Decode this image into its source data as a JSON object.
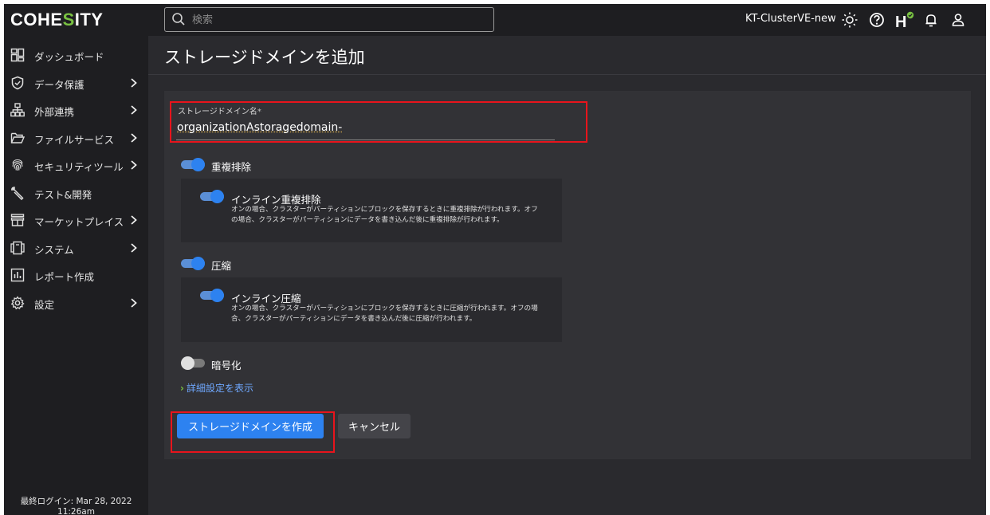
{
  "brand": {
    "logo_left": "COHE",
    "logo_accent": "S",
    "logo_right": "ITY",
    "accent_color": "#79c142"
  },
  "search": {
    "placeholder": "検索"
  },
  "topbar": {
    "cluster_name": "KT-ClusterVE-new",
    "icons": [
      "theme-sun-icon",
      "help-icon",
      "health-icon",
      "notification-bell-icon",
      "user-icon"
    ]
  },
  "sidebar": {
    "items": [
      {
        "label": "ダッシュボード",
        "icon": "dashboard-icon",
        "has_chevron": false
      },
      {
        "label": "データ保護",
        "icon": "shield-icon",
        "has_chevron": true
      },
      {
        "label": "外部連携",
        "icon": "hierarchy-icon",
        "has_chevron": true
      },
      {
        "label": "ファイルサービス",
        "icon": "folder-icon",
        "has_chevron": true
      },
      {
        "label": "セキュリティツール",
        "icon": "fingerprint-icon",
        "has_chevron": true
      },
      {
        "label": "テスト&開発",
        "icon": "wrench-icon",
        "has_chevron": false
      },
      {
        "label": "マーケットプレイス",
        "icon": "store-icon",
        "has_chevron": true
      },
      {
        "label": "システム",
        "icon": "system-icon",
        "has_chevron": true
      },
      {
        "label": "レポート作成",
        "icon": "report-icon",
        "has_chevron": false
      },
      {
        "label": "設定",
        "icon": "gear-icon",
        "has_chevron": true
      }
    ],
    "last_login_line1": "最終ログイン: Mar 28, 2022",
    "last_login_line2": "11:26am"
  },
  "page": {
    "title": "ストレージドメインを追加"
  },
  "form": {
    "name_label": "ストレージドメイン名",
    "name_required_mark": "*",
    "name_value": "organizationAstoragedomain-",
    "dedup": {
      "label": "重複排除",
      "enabled": true,
      "inline_label": "インライン重複排除",
      "inline_enabled": true,
      "inline_desc_line1": "オンの場合、クラスターがパーティションにブロックを保存するときに重複排除が行われます。オフ",
      "inline_desc_line2": "の場合、クラスターがパーティションにデータを書き込んだ後に重複排除が行われます。"
    },
    "compression": {
      "label": "圧縮",
      "enabled": true,
      "inline_label": "インライン圧縮",
      "inline_enabled": true,
      "inline_desc_line1": "オンの場合、クラスターがパーティションにブロックを保存するときに圧縮が行われます。オフの場",
      "inline_desc_line2": "合、クラスターがパーティションにデータを書き込んだ後に圧縮が行われます。"
    },
    "encryption": {
      "label": "暗号化",
      "enabled": false
    },
    "advanced_link": "詳細設定を表示",
    "create_button": "ストレージドメインを作成",
    "cancel_button": "キャンセル"
  },
  "colors": {
    "primary": "#2d82f0",
    "highlight": "#e8141c",
    "link": "#6fa8ff"
  }
}
